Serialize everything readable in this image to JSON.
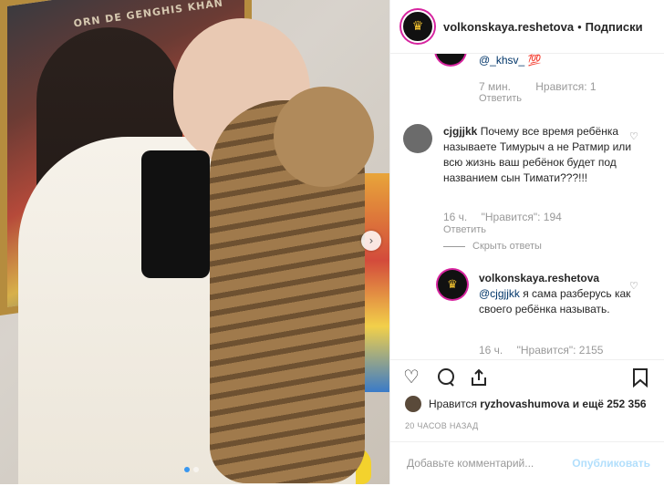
{
  "photo": {
    "painting_text": "ORN DE GENGHIS KHAN"
  },
  "header": {
    "username": "volkonskaya.reshetova",
    "separator": "•",
    "follow_label": "Подписки"
  },
  "comments": {
    "top_reply": {
      "mention": "@_khsv_",
      "emoji": "💯",
      "time": "7 мин.",
      "likes": "Нравится: 1",
      "reply_label": "Ответить"
    },
    "main": {
      "username": "cjgjjkk",
      "text": "Почему все время ребёнка называете Тимурыч а не Ратмир или всю жизнь ваш ребёнок будет под названием сын Тимати???!!!",
      "time": "16 ч.",
      "likes": "\"Нравится\": 194",
      "reply_label": "Ответить",
      "hide_replies": "Скрыть ответы"
    },
    "reply": {
      "username": "volkonskaya.reshetova",
      "mention": "@cjgjjkk",
      "text": "я сама разберусь как своего ребёнка называть.",
      "time": "16 ч.",
      "likes": "\"Нравится\": 2155"
    }
  },
  "actions": {
    "like_icon": "heart-outline",
    "comment_icon": "speech-bubble",
    "share_icon": "share-upload",
    "save_icon": "bookmark"
  },
  "likes": {
    "prefix": "Нравится",
    "user": "ryzhovashumova",
    "suffix": "и ещё 252 356"
  },
  "timestamp": "20 ЧАСОВ НАЗАД",
  "add_comment": {
    "placeholder": "Добавьте комментарий...",
    "publish_label": "Опубликовать"
  },
  "colors": {
    "accent": "#3897f0",
    "publish_disabled": "#b2dffc",
    "story_ring": "#d6249f"
  }
}
